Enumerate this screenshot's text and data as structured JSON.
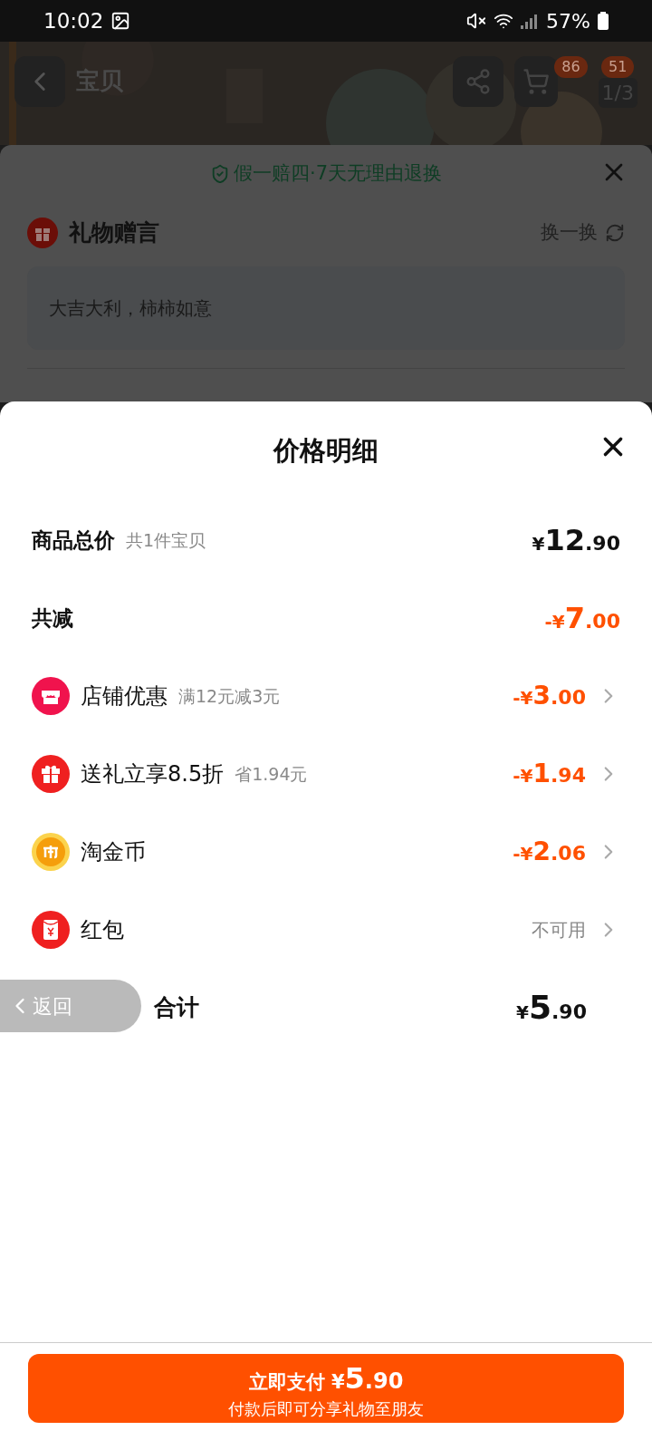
{
  "status_bar": {
    "time": "10:02",
    "battery": "57%"
  },
  "header": {
    "title": "宝贝",
    "cart_count": "86",
    "gallery_count": "51",
    "gallery_index": "1/3"
  },
  "gift_sheet": {
    "guarantee": "假一赔四·7天无理由退换",
    "section_title": "礼物赠言",
    "refresh": "换一换",
    "message": "大吉大利，柿柿如意"
  },
  "price_sheet": {
    "title": "价格明细",
    "subtotal": {
      "label": "商品总价",
      "note": "共1件宝贝",
      "currency": "¥",
      "integer": "12",
      "decimal": ".90"
    },
    "reduction": {
      "label": "共减",
      "sign": "-",
      "currency": "¥",
      "integer": "7",
      "decimal": ".00"
    },
    "discounts": [
      {
        "kind": "shop",
        "label": "店铺优惠",
        "note": "满12元减3元",
        "available": true,
        "sign": "-",
        "currency": "¥",
        "integer": "3",
        "decimal": ".00"
      },
      {
        "kind": "gift",
        "label": "送礼立享8.5折",
        "note": "省1.94元",
        "available": true,
        "sign": "-",
        "currency": "¥",
        "integer": "1",
        "decimal": ".94"
      },
      {
        "kind": "coin",
        "label": "淘金币",
        "available": true,
        "sign": "-",
        "currency": "¥",
        "integer": "2",
        "decimal": ".06"
      },
      {
        "kind": "redpacket",
        "label": "红包",
        "available": false,
        "status": "不可用"
      }
    ],
    "total": {
      "label": "合计",
      "currency": "¥",
      "integer": "5",
      "decimal": ".90"
    }
  },
  "back_pill": {
    "label": "返回"
  },
  "pay_button": {
    "label": "立即支付",
    "currency": "¥",
    "integer": "5",
    "decimal": ".90",
    "subtitle": "付款后即可分享礼物至朋友"
  }
}
